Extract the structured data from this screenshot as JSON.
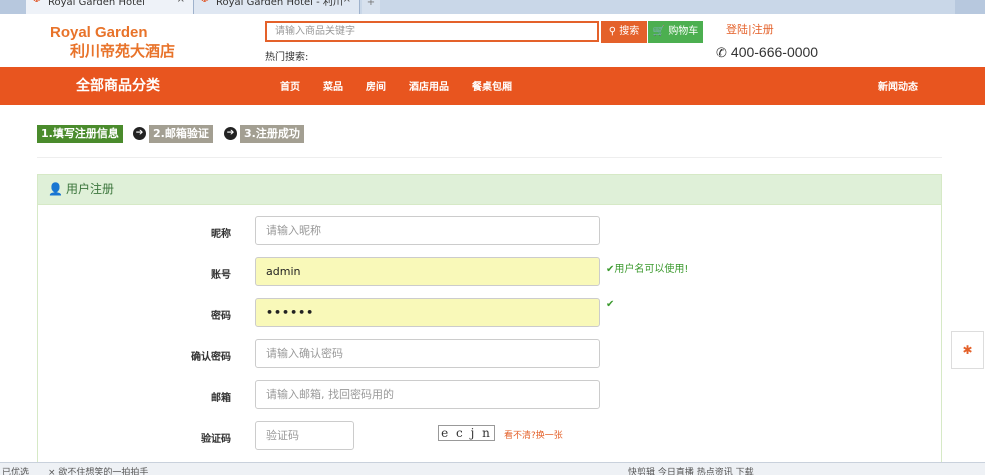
{
  "browser": {
    "tabs": [
      {
        "title": "Royal Garden Hotel"
      },
      {
        "title": "Royal Garden Hotel - 利川"
      }
    ],
    "new_tab": "+",
    "close_glyph": "×"
  },
  "header": {
    "logo_en": "Royal Garden",
    "logo_cn": "利川帝苑大酒店",
    "search_placeholder": "请输入商品关键字",
    "search_button": "搜索",
    "cart_button": "购物车",
    "hot_search_label": "热门搜索:",
    "login_register": "登陆|注册",
    "phone": "400-666-0000"
  },
  "nav": {
    "category": "全部商品分类",
    "items": [
      "首页",
      "菜品",
      "房间",
      "酒店用品",
      "餐桌包厢"
    ],
    "news": "新闻动态",
    "color": "#e8551f"
  },
  "steps": [
    "1.填写注册信息",
    "2.邮箱验证",
    "3.注册成功"
  ],
  "panel": {
    "title": "用户注册"
  },
  "form": {
    "nickname": {
      "label": "昵称",
      "placeholder": "请输入昵称"
    },
    "account": {
      "label": "账号",
      "value": "admin",
      "hint": "用户名可以使用!"
    },
    "password": {
      "label": "密码",
      "value": "••••••"
    },
    "confirm": {
      "label": "确认密码",
      "placeholder": "请输入确认密码"
    },
    "email": {
      "label": "邮箱",
      "placeholder": "请输入邮箱, 找回密码用的"
    },
    "captcha": {
      "label": "验证码",
      "placeholder": "验证码",
      "image_text": "e c j n",
      "refresh_link": "看不清?换一张"
    }
  },
  "statusbar": {
    "left": "已优选",
    "middle": "× 欲不住想笑的一拍拍手",
    "right": "快剪辑  今日直播  热点资讯  下载"
  },
  "icons": [
    "search-icon",
    "cart-icon",
    "phone-icon",
    "user-icon",
    "arrow-right-icon",
    "check-icon",
    "back-to-top-icon"
  ]
}
